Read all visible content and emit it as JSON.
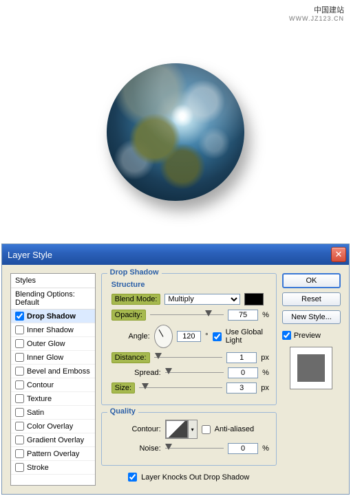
{
  "watermark": {
    "line1": "中国建站",
    "line2": "WWW.JZ123.CN"
  },
  "dialog": {
    "title": "Layer Style",
    "styles_header": "Styles",
    "blending_label": "Blending Options: Default",
    "effects": [
      {
        "label": "Drop Shadow",
        "checked": true,
        "active": true
      },
      {
        "label": "Inner Shadow",
        "checked": false
      },
      {
        "label": "Outer Glow",
        "checked": false
      },
      {
        "label": "Inner Glow",
        "checked": false
      },
      {
        "label": "Bevel and Emboss",
        "checked": false
      },
      {
        "label": "Contour",
        "checked": false,
        "indent": true
      },
      {
        "label": "Texture",
        "checked": false,
        "indent": true
      },
      {
        "label": "Satin",
        "checked": false
      },
      {
        "label": "Color Overlay",
        "checked": false
      },
      {
        "label": "Gradient Overlay",
        "checked": false
      },
      {
        "label": "Pattern Overlay",
        "checked": false
      },
      {
        "label": "Stroke",
        "checked": false
      }
    ],
    "panel": {
      "title": "Drop Shadow",
      "structure": {
        "heading": "Structure",
        "blend_mode_label": "Blend Mode:",
        "blend_mode_value": "Multiply",
        "color": "#000000",
        "opacity_label": "Opacity:",
        "opacity_value": "75",
        "angle_label": "Angle:",
        "angle_value": "120",
        "angle_unit": "°",
        "use_global": "Use Global Light",
        "distance_label": "Distance:",
        "distance_value": "1",
        "spread_label": "Spread:",
        "spread_value": "0",
        "size_label": "Size:",
        "size_value": "3",
        "pct": "%",
        "px": "px"
      },
      "quality": {
        "heading": "Quality",
        "contour_label": "Contour:",
        "antialiased": "Anti-aliased",
        "noise_label": "Noise:",
        "noise_value": "0",
        "pct": "%"
      },
      "knockout": "Layer Knocks Out Drop Shadow"
    },
    "buttons": {
      "ok": "OK",
      "reset": "Reset",
      "newstyle": "New Style...",
      "preview": "Preview"
    }
  }
}
